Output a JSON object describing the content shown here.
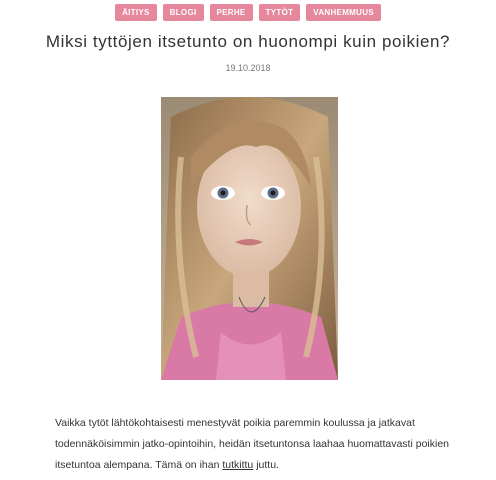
{
  "tags": [
    "ÄITIYS",
    "BLOGI",
    "PERHE",
    "TYTÖT",
    "VANHEMMUUS"
  ],
  "article": {
    "title": "Miksi tyttöjen itsetunto on huonompi kuin poikien?",
    "date": "19.10.2018",
    "paragraph_before_link": "Vaikka tytöt lähtökohtaisesti menestyvät poikia paremmin koulussa ja jatkavat todennäköisimmin jatko-opintoihin, heidän itsetuntonsa laahaa huomattavasti poikien itsetuntoa alempana. Tämä on ihan ",
    "link_text": "tutkittu",
    "paragraph_after_link": " juttu."
  },
  "colors": {
    "tag_bg": "#e6879b",
    "tag_text": "#ffffff"
  }
}
